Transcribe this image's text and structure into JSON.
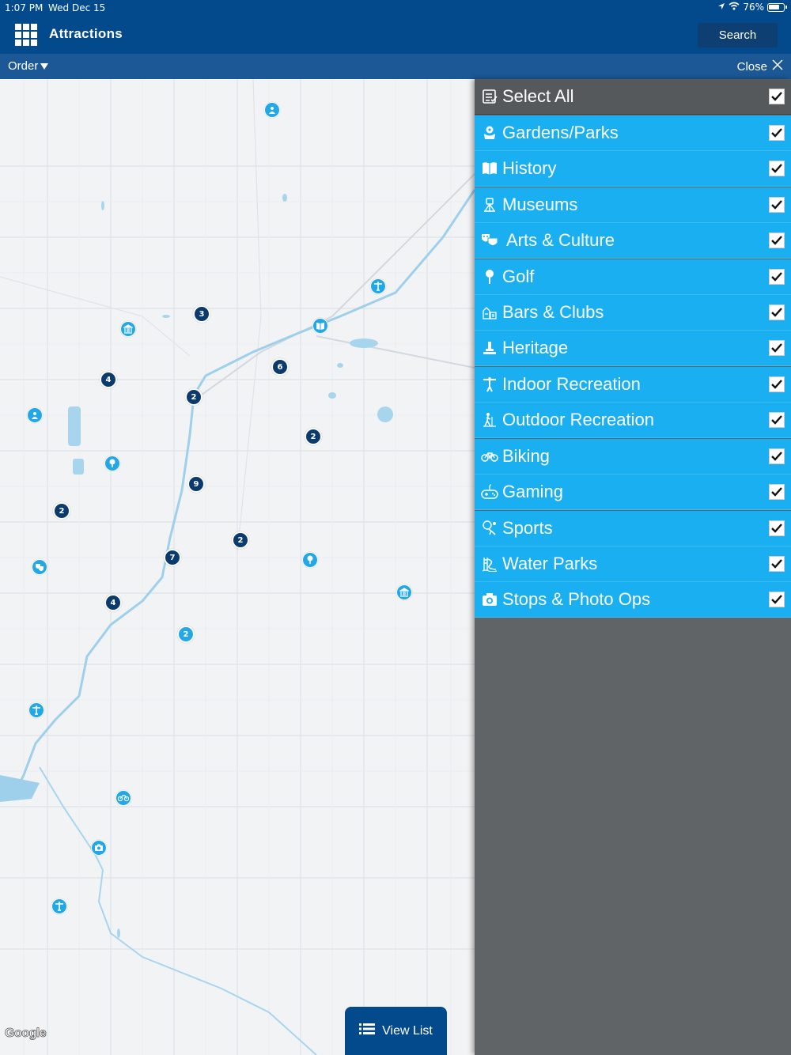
{
  "status_bar": {
    "time": "1:07 PM",
    "date": "Wed Dec 15",
    "battery": "76%"
  },
  "header": {
    "title": "Attractions",
    "search_label": "Search"
  },
  "subbar": {
    "order_label": "Order",
    "close_label": "Close"
  },
  "map": {
    "attribution": "Google",
    "view_list_label": "View List",
    "clusters": [
      {
        "count": "3",
        "kind": "dark"
      },
      {
        "count": "4",
        "kind": "dark"
      },
      {
        "count": "2",
        "kind": "dark"
      },
      {
        "count": "6",
        "kind": "dark"
      },
      {
        "count": "2",
        "kind": "dark"
      },
      {
        "count": "9",
        "kind": "dark"
      },
      {
        "count": "2",
        "kind": "dark"
      },
      {
        "count": "2",
        "kind": "dark"
      },
      {
        "count": "7",
        "kind": "dark"
      },
      {
        "count": "4",
        "kind": "dark"
      },
      {
        "count": "2",
        "kind": "light"
      }
    ],
    "pins": [
      {
        "icon": "outdoor-recreation-icon"
      },
      {
        "icon": "indoor-recreation-icon"
      },
      {
        "icon": "museum-icon"
      },
      {
        "icon": "history-icon"
      },
      {
        "icon": "outdoor-recreation-icon"
      },
      {
        "icon": "golf-icon"
      },
      {
        "icon": "arts-culture-icon"
      },
      {
        "icon": "golf-icon"
      },
      {
        "icon": "museum-icon"
      },
      {
        "icon": "indoor-recreation-icon"
      },
      {
        "icon": "biking-icon"
      },
      {
        "icon": "camera-icon"
      },
      {
        "icon": "indoor-recreation-icon"
      }
    ]
  },
  "filters": {
    "select_all": {
      "label": "Select All",
      "checked": true,
      "icon": "checklist-icon"
    },
    "categories": [
      {
        "label": "Gardens/Parks",
        "checked": true,
        "icon": "garden-icon"
      },
      {
        "label": "History",
        "checked": true,
        "icon": "book-icon"
      },
      {
        "label": "Museums",
        "checked": true,
        "icon": "museum-icon"
      },
      {
        "label": "Arts & Culture",
        "checked": true,
        "icon": "masks-icon"
      },
      {
        "label": "Golf",
        "checked": true,
        "icon": "golf-icon"
      },
      {
        "label": "Bars & Clubs",
        "checked": true,
        "icon": "bar-icon"
      },
      {
        "label": "Heritage",
        "checked": true,
        "icon": "monument-icon"
      },
      {
        "label": "Indoor Recreation",
        "checked": true,
        "icon": "weightlifter-icon"
      },
      {
        "label": "Outdoor Recreation",
        "checked": true,
        "icon": "hiker-icon"
      },
      {
        "label": "Biking",
        "checked": true,
        "icon": "bicycle-icon"
      },
      {
        "label": "Gaming",
        "checked": true,
        "icon": "dice-icon"
      },
      {
        "label": "Sports",
        "checked": true,
        "icon": "sports-icon"
      },
      {
        "label": "Water Parks",
        "checked": true,
        "icon": "waterslide-icon"
      },
      {
        "label": "Stops & Photo Ops",
        "checked": true,
        "icon": "camera-icon"
      }
    ]
  },
  "colors": {
    "header": "#034a8c",
    "subbar": "#1c5796",
    "category_row": "#1aaff0",
    "panel": "#606466",
    "cluster": "#0b3b6e",
    "pin": "#22a8e6"
  }
}
